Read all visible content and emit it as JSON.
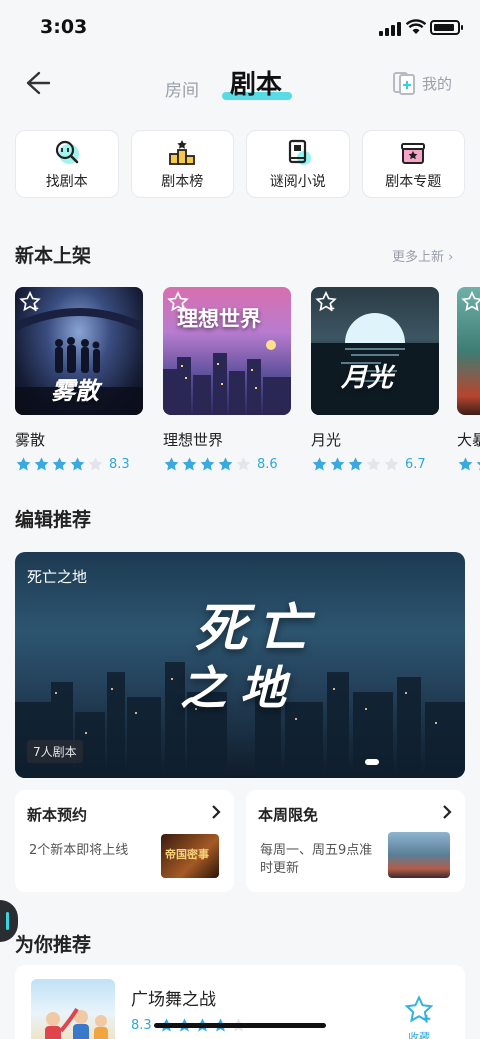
{
  "status": {
    "time": "3:03"
  },
  "nav": {
    "tab_room": "房间",
    "tab_script": "剧本",
    "mine_label": "我的"
  },
  "quick": [
    {
      "label": "找剧本",
      "icon": "search-script-icon"
    },
    {
      "label": "剧本榜",
      "icon": "podium-icon"
    },
    {
      "label": "谜阅小说",
      "icon": "book-icon"
    },
    {
      "label": "剧本专题",
      "icon": "topic-box-icon"
    }
  ],
  "new_section": {
    "title": "新本上架",
    "more": "更多上新",
    "items": [
      {
        "title": "雾散",
        "cover_text": "雾散",
        "score": "8.3",
        "stars": 4
      },
      {
        "title": "理想世界",
        "cover_text": "理想世界",
        "score": "8.6",
        "stars": 4
      },
      {
        "title": "月光",
        "cover_text": "月光",
        "score": "6.7",
        "stars": 3
      },
      {
        "title": "大暴",
        "cover_text": "",
        "score": "",
        "stars": 4
      }
    ]
  },
  "editor_section": {
    "title": "编辑推荐",
    "banner": {
      "name": "死亡之地",
      "art_text_1": "死亡",
      "art_text_2": "之地",
      "tag": "7人剧本"
    }
  },
  "promos": [
    {
      "title": "新本预约",
      "desc": "2个新本即将上线",
      "thumb_text": "帝国密事"
    },
    {
      "title": "本周限免",
      "desc": "每周一、周五9点准时更新",
      "thumb_text": ""
    }
  ],
  "rec_section": {
    "title": "为你推荐",
    "item": {
      "title": "广场舞之战",
      "score": "8.3",
      "fav_label": "收藏"
    }
  },
  "colors": {
    "accent": "#30d3e0",
    "star": "#39a9e0",
    "star_empty": "#e3e5ea"
  }
}
